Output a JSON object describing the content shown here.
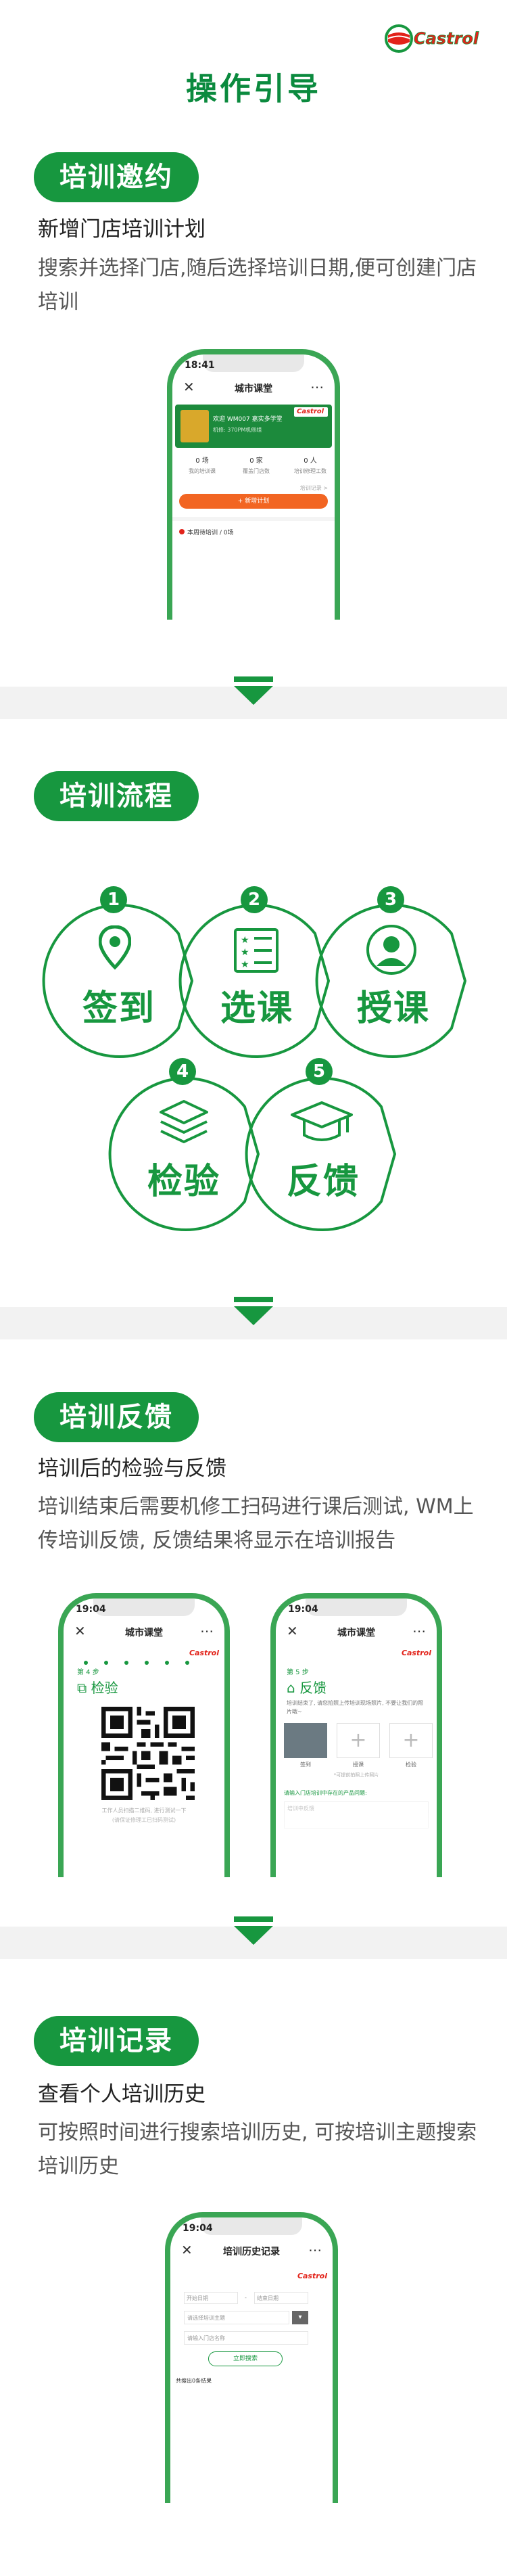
{
  "brand": {
    "logo_text": "Castrol",
    "green": "#17973f",
    "red": "#e2231a"
  },
  "page_title": "操作引导",
  "section1": {
    "pill": "培训邀约",
    "subtitle": "新增门店培训计划",
    "desc": "搜索并选择门店,随后选择培训日期,便可创建门店培训",
    "phone": {
      "time": "18:41",
      "title": "城市课堂",
      "banner_line1": "欢迎 WM007 嘉实多学堂",
      "banner_line2": "机修: 370PM机修组",
      "stats": [
        {
          "num": "0 场",
          "label": "我的培训课"
        },
        {
          "num": "0 家",
          "label": "覆盖门店数"
        },
        {
          "num": "0 人",
          "label": "培训修理工数"
        }
      ],
      "link": "培训记录 >",
      "button": "+ 新增计划",
      "footer": "本周待培训 / 0场"
    }
  },
  "section2": {
    "pill": "培训流程",
    "steps": [
      {
        "num": "1",
        "label": "签到",
        "icon": "location-pin-icon"
      },
      {
        "num": "2",
        "label": "选课",
        "icon": "course-list-icon"
      },
      {
        "num": "3",
        "label": "授课",
        "icon": "teacher-icon"
      },
      {
        "num": "4",
        "label": "检验",
        "icon": "layers-icon"
      },
      {
        "num": "5",
        "label": "反馈",
        "icon": "graduation-cap-icon"
      }
    ]
  },
  "section3": {
    "pill": "培训反馈",
    "subtitle": "培训后的检验与反馈",
    "desc": "培训结束后需要机修工扫码进行课后测试, WM上传培训反馈, 反馈结果将显示在培训报告",
    "phone_left": {
      "time": "19:04",
      "title": "城市课堂",
      "step": "第 4 步",
      "step_title": "检验",
      "caption1": "工作人员扫描二维码, 进行测试一下",
      "caption2": "(请保证修理工已扫码测试)"
    },
    "phone_right": {
      "time": "19:04",
      "title": "城市课堂",
      "step": "第 5 步",
      "step_title": "反馈",
      "note": "培训结束了, 请您拍照上传培训现场照片, 不要让我们的照片哦~",
      "photo_labels": [
        "签到",
        "授课",
        "检验"
      ],
      "hint": "*可提前拍照上传照片",
      "link": "请输入门店培训中存在的产品问题:",
      "placeholder": "培训中反馈"
    }
  },
  "section4": {
    "pill": "培训记录",
    "subtitle": "查看个人培训历史",
    "desc": "可按照时间进行搜索培训历史, 可按培训主题搜索培训历史",
    "phone": {
      "time": "19:04",
      "title": "培训历史记录",
      "start_date": "开始日期",
      "end_date": "结束日期",
      "topic_placeholder": "请选择培训主题",
      "store_placeholder": "请输入门店名称",
      "search_button": "立即搜索",
      "result": "共搜出0条结果"
    }
  }
}
